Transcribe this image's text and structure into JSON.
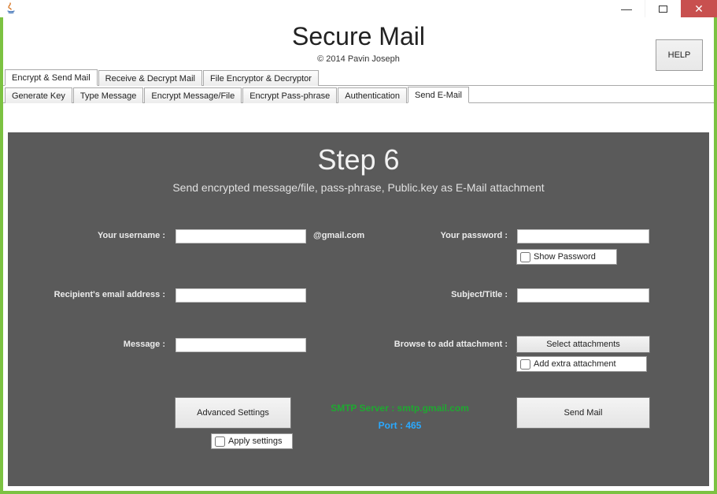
{
  "titlebar": {
    "java_icon": "java-icon"
  },
  "win": {
    "minimize": "—",
    "maximize": "▢",
    "close": "✕"
  },
  "header": {
    "title": "Secure Mail",
    "copyright": "© 2014 Pavin Joseph",
    "help": "HELP"
  },
  "tabs_outer": {
    "items": [
      {
        "label": "Encrypt & Send Mail",
        "active": true
      },
      {
        "label": "Receive & Decrypt Mail",
        "active": false
      },
      {
        "label": "File Encryptor & Decryptor",
        "active": false
      }
    ]
  },
  "tabs_inner": {
    "items": [
      {
        "label": "Generate Key",
        "active": false
      },
      {
        "label": "Type Message",
        "active": false
      },
      {
        "label": "Encrypt Message/File",
        "active": false
      },
      {
        "label": "Encrypt Pass-phrase",
        "active": false
      },
      {
        "label": "Authentication",
        "active": false
      },
      {
        "label": "Send E-Mail",
        "active": true
      }
    ]
  },
  "step": {
    "title": "Step 6",
    "desc": "Send encrypted message/file, pass-phrase, Public.key as E-Mail attachment"
  },
  "form": {
    "username_label": "Your username :",
    "username_value": "",
    "domain": "@gmail.com",
    "password_label": "Your password :",
    "password_value": "",
    "show_password_label": "Show Password",
    "recipient_label": "Recipient's email address :",
    "recipient_value": "",
    "subject_label": "Subject/Title :",
    "subject_value": "",
    "message_label": "Message :",
    "message_value": "",
    "browse_label": "Browse to add attachment :",
    "select_attachments": "Select attachments",
    "add_extra_attachment": "Add extra attachment",
    "advanced_settings": "Advanced Settings",
    "apply_settings": "Apply settings",
    "send_mail": "Send Mail"
  },
  "smtp": {
    "server": "SMTP Server : smtp.gmail.com",
    "port": "Port : 465"
  }
}
